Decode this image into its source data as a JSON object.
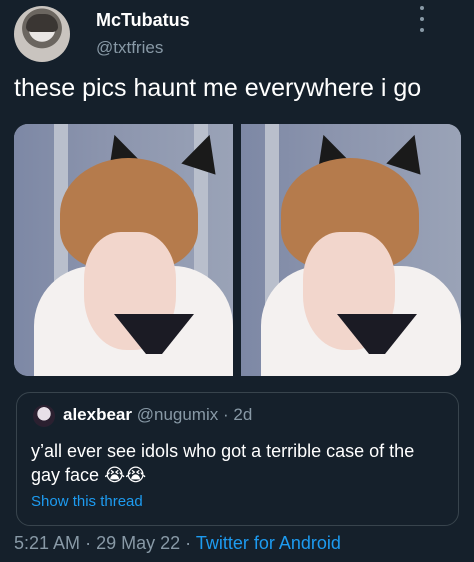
{
  "author": {
    "display_name": "McTubatus",
    "handle": "@txtfries"
  },
  "tweet": {
    "text": "these pics haunt me everywhere i go"
  },
  "media": {
    "icon_names": [
      "photo-cat-ears-1",
      "photo-cat-ears-2"
    ]
  },
  "quoted_tweet": {
    "display_name": "alexbear",
    "handle": "@nugumix",
    "separator": "·",
    "time": "2d",
    "text": "y’all ever see idols who got a terrible case of the gay face",
    "emoji": "😭😭",
    "show_thread": "Show this thread"
  },
  "footer": {
    "time": "5:21 AM",
    "separator_1": "·",
    "date": "29 May 22",
    "separator_2": "·",
    "source": "Twitter for Android"
  },
  "colors": {
    "background": "#15202b",
    "secondary_text": "#8899a6",
    "link": "#1d9bf0",
    "border": "#38444d"
  }
}
